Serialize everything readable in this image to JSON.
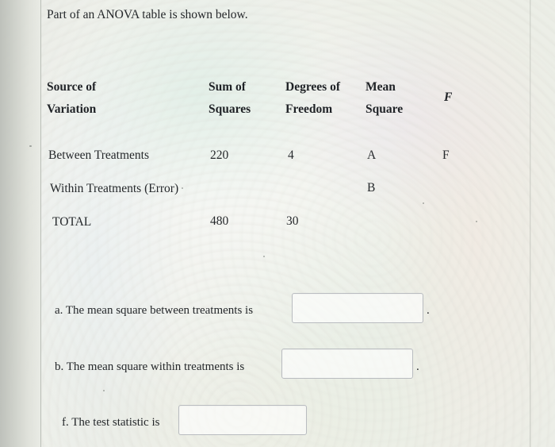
{
  "document": {
    "intro": "Part of an ANOVA table is shown below.",
    "table": {
      "headers": [
        {
          "line1": "Source of",
          "line2": "Variation"
        },
        {
          "line1": "Sum of",
          "line2": "Squares"
        },
        {
          "line1": "Degrees of",
          "line2": "Freedom"
        },
        {
          "line1": "Mean",
          "line2": "Square"
        },
        {
          "line1": "F",
          "line2": ""
        }
      ],
      "rows": [
        {
          "source": "Between Treatments",
          "sum_of_squares": "220",
          "degrees_of_freedom": "4",
          "mean_square": "A",
          "f": "F"
        },
        {
          "source": "Within Treatments (Error)",
          "sum_of_squares": "",
          "degrees_of_freedom": "",
          "mean_square": "B",
          "f": ""
        },
        {
          "source": "TOTAL",
          "sum_of_squares": "480",
          "degrees_of_freedom": "30",
          "mean_square": "",
          "f": ""
        }
      ]
    },
    "questions": [
      {
        "label": "a. The mean square between treatments is",
        "value": "",
        "trailing": "."
      },
      {
        "label": "b. The mean square within treatments is",
        "value": "",
        "trailing": "."
      },
      {
        "label": "f. The test statistic is",
        "value": "",
        "trailing": ""
      }
    ]
  }
}
